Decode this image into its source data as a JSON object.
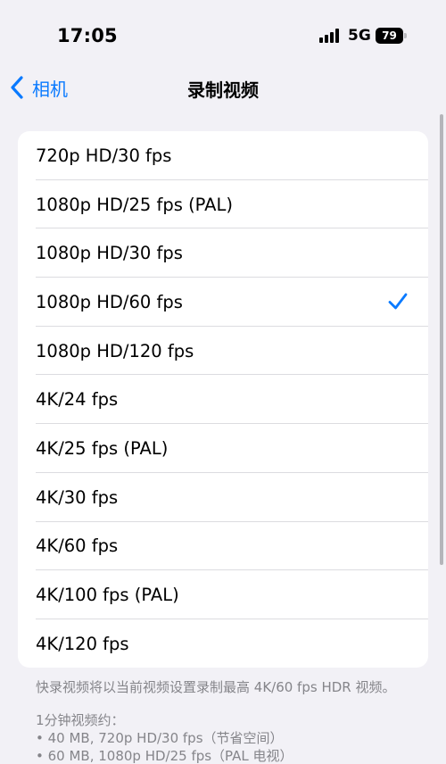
{
  "status_bar": {
    "time": "17:05",
    "network": "5G",
    "battery_level": "79",
    "signal_icon": "signal-bars-icon",
    "battery_icon": "battery-icon"
  },
  "nav": {
    "back_label": "相机",
    "back_icon": "chevron-left-icon",
    "title": "录制视频"
  },
  "options": [
    {
      "label": "720p HD/30 fps",
      "selected": false
    },
    {
      "label": "1080p HD/25 fps (PAL)",
      "selected": false
    },
    {
      "label": "1080p HD/30 fps",
      "selected": false
    },
    {
      "label": "1080p HD/60 fps",
      "selected": true
    },
    {
      "label": "1080p HD/120 fps",
      "selected": false
    },
    {
      "label": "4K/24 fps",
      "selected": false
    },
    {
      "label": "4K/25 fps (PAL)",
      "selected": false
    },
    {
      "label": "4K/30 fps",
      "selected": false
    },
    {
      "label": "4K/60 fps",
      "selected": false
    },
    {
      "label": "4K/100 fps (PAL)",
      "selected": false
    },
    {
      "label": "4K/120 fps",
      "selected": false
    }
  ],
  "footer": {
    "note": "快录视频将以当前视频设置录制最高 4K/60 fps HDR 视频。",
    "estimate_title": "1分钟视频约：",
    "estimates": [
      "• 40 MB, 720p HD/30 fps（节省空间）",
      "• 60 MB, 1080p HD/25 fps（PAL 电视）"
    ]
  },
  "colors": {
    "accent": "#0a7aff",
    "background": "#f2f1f6",
    "secondary_text": "#85858a"
  }
}
